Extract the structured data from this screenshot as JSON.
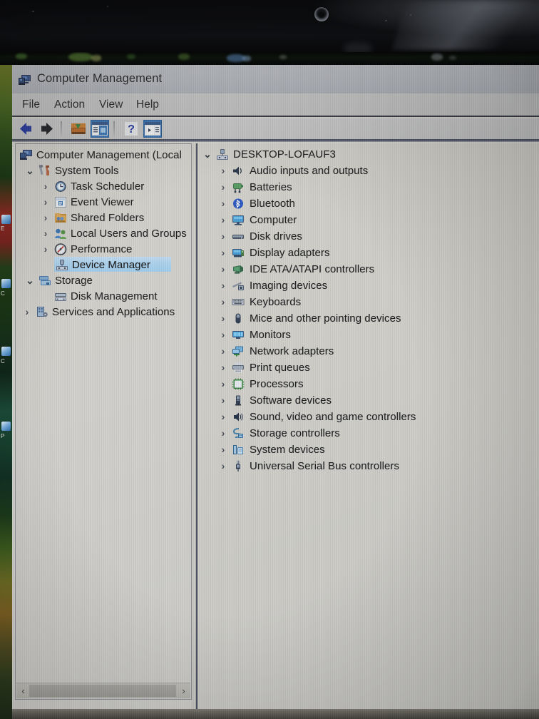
{
  "photo": {
    "subject": "photograph of a laptop screen showing the Windows Computer Management console",
    "bezel_color": "#0e0f12",
    "screen_background": "#c9c7c0"
  },
  "window": {
    "title": "Computer Management",
    "title_icon": "computer-management-icon",
    "titlebar_color": "#b5b9c2",
    "menu": [
      {
        "label": "File"
      },
      {
        "label": "Action"
      },
      {
        "label": "View"
      },
      {
        "label": "Help"
      }
    ],
    "toolbar": [
      {
        "name": "back-button",
        "icon": "left-arrow-icon",
        "label": "Back",
        "state": "enabled"
      },
      {
        "name": "forward-button",
        "icon": "right-arrow-icon",
        "label": "Forward",
        "state": "enabled"
      },
      {
        "name": "separator-1",
        "icon": "separator",
        "label": "",
        "state": "static"
      },
      {
        "name": "up-one-level-button",
        "icon": "folder-up-icon",
        "label": "Up One Level",
        "state": "enabled"
      },
      {
        "name": "show-hide-console-tree-button",
        "icon": "console-tree-icon",
        "label": "Show/Hide Console Tree",
        "state": "selected"
      },
      {
        "name": "separator-2",
        "icon": "separator",
        "label": "",
        "state": "static"
      },
      {
        "name": "help-button",
        "icon": "question-mark-icon",
        "label": "Help",
        "state": "enabled"
      },
      {
        "name": "properties-button",
        "icon": "properties-pane-icon",
        "label": "Properties",
        "state": "selected"
      }
    ]
  },
  "tree": {
    "root": {
      "label": "Computer Management (Local",
      "icon": "computer-management-icon",
      "indent": 0,
      "twisty": "",
      "selected": false
    },
    "items": [
      {
        "label": "System Tools",
        "icon": "system-tools-icon",
        "indent": 1,
        "twisty": "open",
        "selected": false
      },
      {
        "label": "Task Scheduler",
        "icon": "clock-icon",
        "indent": 2,
        "twisty": "collapsed",
        "selected": false
      },
      {
        "label": "Event Viewer",
        "icon": "event-viewer-icon",
        "indent": 2,
        "twisty": "collapsed",
        "selected": false
      },
      {
        "label": "Shared Folders",
        "icon": "shared-folders-icon",
        "indent": 2,
        "twisty": "collapsed",
        "selected": false
      },
      {
        "label": "Local Users and Groups",
        "icon": "users-group-icon",
        "indent": 2,
        "twisty": "collapsed",
        "selected": false
      },
      {
        "label": "Performance",
        "icon": "performance-icon",
        "indent": 2,
        "twisty": "collapsed",
        "selected": false
      },
      {
        "label": "Device Manager",
        "icon": "device-manager-icon",
        "indent": 2,
        "twisty": "",
        "selected": true
      },
      {
        "label": "Storage",
        "icon": "storage-icon",
        "indent": 1,
        "twisty": "open",
        "selected": false
      },
      {
        "label": "Disk Management",
        "icon": "disk-management-icon",
        "indent": 2,
        "twisty": "",
        "selected": false
      },
      {
        "label": "Services and Applications",
        "icon": "services-icon",
        "indent": 1,
        "twisty": "collapsed",
        "selected": false
      }
    ],
    "selection_color": "#a9d3f2",
    "scrollbar": {
      "left_arrow": "‹",
      "right_arrow": "›"
    }
  },
  "device_manager": {
    "computer_name": "DESKTOP-LOFAUF3",
    "computer_icon": "computer-node-icon",
    "categories": [
      {
        "label": "Audio inputs and outputs",
        "icon": "speaker-icon"
      },
      {
        "label": "Batteries",
        "icon": "battery-icon"
      },
      {
        "label": "Bluetooth",
        "icon": "bluetooth-icon"
      },
      {
        "label": "Computer",
        "icon": "monitor-icon"
      },
      {
        "label": "Disk drives",
        "icon": "disk-drive-icon"
      },
      {
        "label": "Display adapters",
        "icon": "display-adapter-icon"
      },
      {
        "label": "IDE ATA/ATAPI controllers",
        "icon": "ide-controller-icon"
      },
      {
        "label": "Imaging devices",
        "icon": "imaging-device-icon"
      },
      {
        "label": "Keyboards",
        "icon": "keyboard-icon"
      },
      {
        "label": "Mice and other pointing devices",
        "icon": "mouse-icon"
      },
      {
        "label": "Monitors",
        "icon": "monitor-screen-icon"
      },
      {
        "label": "Network adapters",
        "icon": "network-adapter-icon"
      },
      {
        "label": "Print queues",
        "icon": "printer-icon"
      },
      {
        "label": "Processors",
        "icon": "cpu-icon"
      },
      {
        "label": "Software devices",
        "icon": "software-device-icon"
      },
      {
        "label": "Sound, video and game controllers",
        "icon": "sound-controller-icon"
      },
      {
        "label": "Storage controllers",
        "icon": "storage-controller-icon"
      },
      {
        "label": "System devices",
        "icon": "system-device-icon"
      },
      {
        "label": "Universal Serial Bus controllers",
        "icon": "usb-icon"
      }
    ],
    "twisty_collapsed": "›",
    "twisty_open": "⌄"
  }
}
